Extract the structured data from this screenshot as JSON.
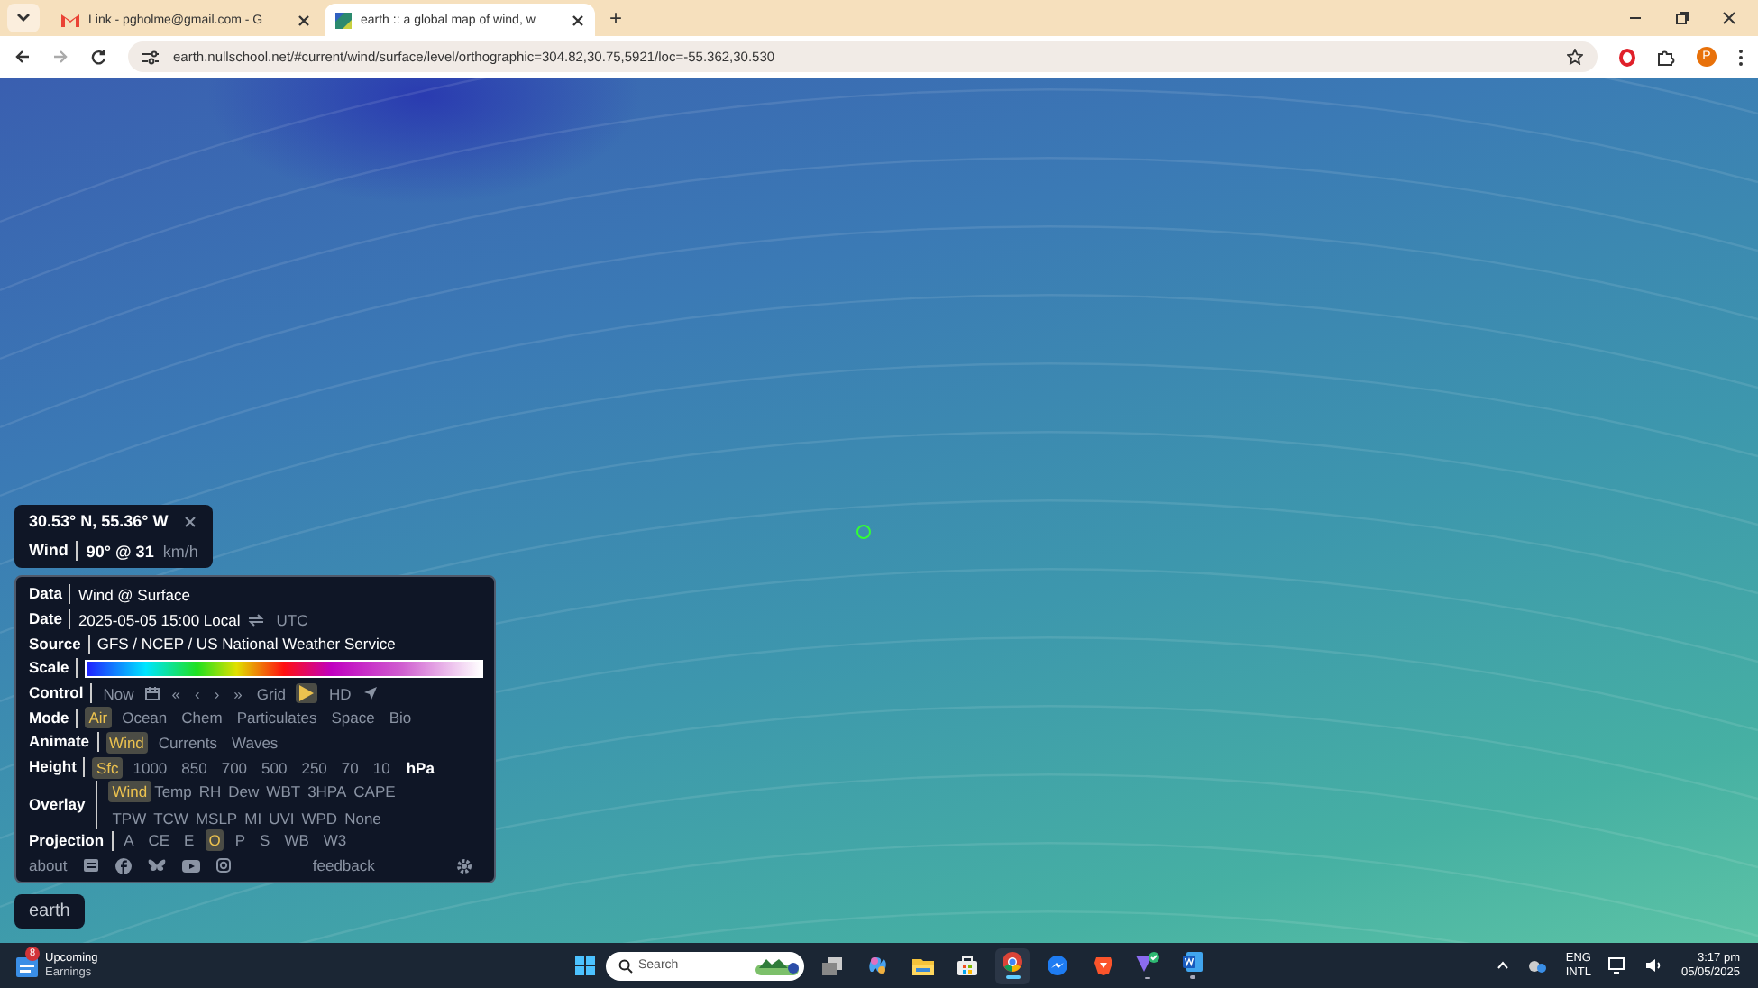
{
  "browser": {
    "tabs": [
      {
        "kind": "gmail",
        "title": "Link - pgholme@gmail.com - G",
        "selected": false
      },
      {
        "kind": "earth",
        "title": "earth :: a global map of wind, w",
        "selected": true
      }
    ],
    "new_tab": "+",
    "url": "earth.nullschool.net/#current/wind/surface/level/orthographic=304.82,30.75,5921/loc=-55.362,30.530",
    "profile": "P"
  },
  "location": {
    "coords": "30.53° N, 55.36° W",
    "label": "Wind",
    "value": "90° @ 31",
    "unit": "km/h"
  },
  "menu": {
    "rows": [
      {
        "label": "Data",
        "items": [
          {
            "kind": "value",
            "text": "Wind @ Surface"
          }
        ]
      },
      {
        "label": "Date",
        "items": [
          {
            "kind": "value",
            "text": "2025-05-05 15:00 Local"
          },
          {
            "kind": "swap"
          },
          {
            "kind": "option",
            "text": "UTC",
            "selected": false
          }
        ]
      },
      {
        "label": "Source",
        "items": [
          {
            "kind": "value",
            "text": "GFS / NCEP / US National Weather Service"
          }
        ]
      },
      {
        "label": "Scale",
        "items": [
          {
            "kind": "scale"
          }
        ]
      },
      {
        "label": "Control",
        "items": [
          {
            "kind": "option",
            "text": "Now",
            "selected": false
          },
          {
            "kind": "calendar"
          },
          {
            "kind": "option",
            "text": "«",
            "selected": false
          },
          {
            "kind": "option",
            "text": "‹",
            "selected": false
          },
          {
            "kind": "option",
            "text": "›",
            "selected": false
          },
          {
            "kind": "option",
            "text": "»",
            "selected": false
          },
          {
            "kind": "option",
            "text": "Grid",
            "selected": false
          },
          {
            "kind": "play",
            "selected": true
          },
          {
            "kind": "option",
            "text": "HD",
            "selected": false
          },
          {
            "kind": "locate"
          }
        ]
      },
      {
        "label": "Mode",
        "items": [
          {
            "kind": "option",
            "text": "Air",
            "selected": true
          },
          {
            "kind": "option",
            "text": "Ocean",
            "selected": false
          },
          {
            "kind": "option",
            "text": "Chem",
            "selected": false
          },
          {
            "kind": "option",
            "text": "Particulates",
            "selected": false
          },
          {
            "kind": "option",
            "text": "Space",
            "selected": false
          },
          {
            "kind": "option",
            "text": "Bio",
            "selected": false
          }
        ]
      },
      {
        "label": "Animate",
        "items": [
          {
            "kind": "option",
            "text": "Wind",
            "selected": true
          },
          {
            "kind": "option",
            "text": "Currents",
            "selected": false
          },
          {
            "kind": "option",
            "text": "Waves",
            "selected": false
          }
        ]
      },
      {
        "label": "Height",
        "items": [
          {
            "kind": "option",
            "text": "Sfc",
            "selected": true
          },
          {
            "kind": "option",
            "text": "1000",
            "selected": false
          },
          {
            "kind": "option",
            "text": "850",
            "selected": false
          },
          {
            "kind": "option",
            "text": "700",
            "selected": false
          },
          {
            "kind": "option",
            "text": "500",
            "selected": false
          },
          {
            "kind": "option",
            "text": "250",
            "selected": false
          },
          {
            "kind": "option",
            "text": "70",
            "selected": false
          },
          {
            "kind": "option",
            "text": "10",
            "selected": false
          },
          {
            "kind": "unit",
            "text": "hPa"
          }
        ]
      },
      {
        "label": "Overlay",
        "lines": [
          [
            {
              "kind": "option",
              "text": "Wind",
              "selected": true
            },
            {
              "kind": "option",
              "text": "Temp",
              "selected": false
            },
            {
              "kind": "option",
              "text": "RH",
              "selected": false
            },
            {
              "kind": "option",
              "text": "Dew",
              "selected": false
            },
            {
              "kind": "option",
              "text": "WBT",
              "selected": false
            },
            {
              "kind": "option",
              "text": "3HPA",
              "selected": false
            },
            {
              "kind": "option",
              "text": "CAPE",
              "selected": false
            }
          ],
          [
            {
              "kind": "option",
              "text": "TPW",
              "selected": false
            },
            {
              "kind": "option",
              "text": "TCW",
              "selected": false
            },
            {
              "kind": "option",
              "text": "MSLP",
              "selected": false
            },
            {
              "kind": "option",
              "text": "MI",
              "selected": false
            },
            {
              "kind": "option",
              "text": "UVI",
              "selected": false
            },
            {
              "kind": "option",
              "text": "WPD",
              "selected": false
            },
            {
              "kind": "option",
              "text": "None",
              "selected": false
            }
          ]
        ]
      },
      {
        "label": "Projection",
        "items": [
          {
            "kind": "option",
            "text": "A",
            "selected": false
          },
          {
            "kind": "option",
            "text": "CE",
            "selected": false
          },
          {
            "kind": "option",
            "text": "E",
            "selected": false
          },
          {
            "kind": "option",
            "text": "O",
            "selected": true
          },
          {
            "kind": "option",
            "text": "P",
            "selected": false
          },
          {
            "kind": "option",
            "text": "S",
            "selected": false
          },
          {
            "kind": "option",
            "text": "WB",
            "selected": false
          },
          {
            "kind": "option",
            "text": "W3",
            "selected": false
          }
        ]
      }
    ],
    "footer": [
      {
        "kind": "link",
        "text": "about"
      },
      {
        "kind": "news"
      },
      {
        "kind": "facebook"
      },
      {
        "kind": "bluesky"
      },
      {
        "kind": "youtube"
      },
      {
        "kind": "instagram"
      },
      {
        "kind": "feedback",
        "text": "feedback"
      },
      {
        "kind": "gear"
      }
    ]
  },
  "earth_button": "earth",
  "taskbar": {
    "widget": {
      "badge": "8",
      "title": "Upcoming",
      "subtitle": "Earnings"
    },
    "search": {
      "placeholder": "Search"
    },
    "apps": [
      {
        "kind": "taskview",
        "running": false,
        "selected": false
      },
      {
        "kind": "copilot",
        "running": false,
        "selected": false
      },
      {
        "kind": "folder",
        "running": false,
        "selected": false
      },
      {
        "kind": "store",
        "running": false,
        "selected": false
      },
      {
        "kind": "chrome",
        "running": true,
        "selected": true
      },
      {
        "kind": "messenger",
        "running": false,
        "selected": false
      },
      {
        "kind": "brave",
        "running": false,
        "selected": false
      },
      {
        "kind": "vpn",
        "running": true,
        "selected": false
      },
      {
        "kind": "word",
        "running": true,
        "selected": false
      }
    ],
    "language": [
      "ENG",
      "INTL"
    ],
    "time": "3:17 pm",
    "date": "05/05/2025"
  }
}
